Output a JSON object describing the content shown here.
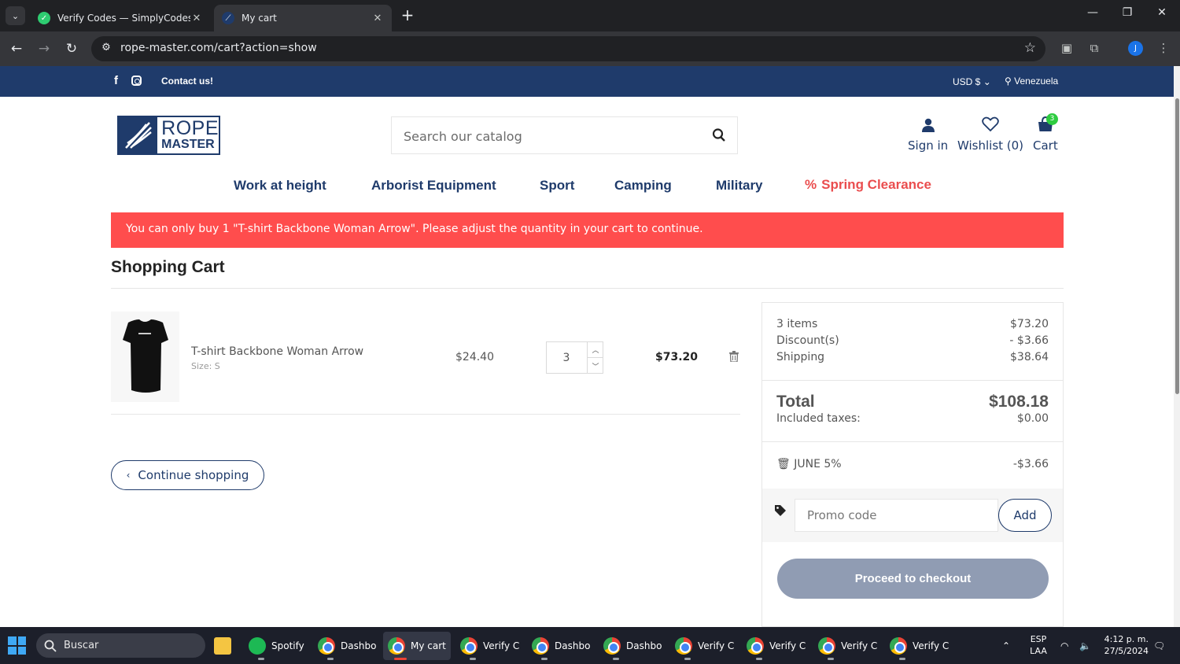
{
  "browser": {
    "tabs": [
      {
        "title": "Verify Codes — SimplyCodes",
        "active": false
      },
      {
        "title": "My cart",
        "active": true
      }
    ],
    "url": "rope-master.com/cart?action=show",
    "profile_initial": "J"
  },
  "topbar": {
    "contact": "Contact us!",
    "currency": "USD $",
    "country": "Venezuela"
  },
  "logo": {
    "line1": "ROPE",
    "line2": "MASTER"
  },
  "search": {
    "placeholder": "Search our catalog"
  },
  "header_links": {
    "sign_in": "Sign in",
    "wishlist": "Wishlist (0)",
    "cart": "Cart",
    "cart_count": "3"
  },
  "menu": [
    "Work at height",
    "Arborist Equipment",
    "Sport",
    "Camping",
    "Military",
    "Spring Clearance"
  ],
  "alert": "You can only buy 1 \"T-shirt Backbone Woman Arrow\". Please adjust the quantity in your cart to continue.",
  "cart": {
    "title": "Shopping Cart",
    "item": {
      "name": "T-shirt Backbone Woman Arrow",
      "size": "Size: S",
      "unit_price": "$24.40",
      "quantity": "3",
      "total": "$73.20"
    },
    "continue_label": "Continue shopping"
  },
  "summary": {
    "items_label": "3 items",
    "items_value": "$73.20",
    "discount_label": "Discount(s)",
    "discount_value": "- $3.66",
    "shipping_label": "Shipping",
    "shipping_value": "$38.64",
    "total_label": "Total",
    "total_value": "$108.18",
    "taxes_label": "Included taxes:",
    "taxes_value": "$0.00",
    "voucher_name": "JUNE 5%",
    "voucher_value": "-$3.66",
    "promo_placeholder": "Promo code",
    "promo_add": "Add",
    "checkout_label": "Proceed to checkout"
  },
  "taskbar": {
    "search_label": "Buscar",
    "items": [
      {
        "label": "Spotify",
        "color": "#1db954"
      },
      {
        "label": "Dashbo",
        "color": "chrome"
      },
      {
        "label": "My cart",
        "color": "chrome"
      },
      {
        "label": "Verify C",
        "color": "chrome"
      },
      {
        "label": "Dashbo",
        "color": "chrome"
      },
      {
        "label": "Dashbo",
        "color": "chrome"
      },
      {
        "label": "Verify C",
        "color": "chrome"
      },
      {
        "label": "Verify C",
        "color": "chrome"
      },
      {
        "label": "Verify C",
        "color": "chrome"
      },
      {
        "label": "Verify C",
        "color": "chrome"
      }
    ],
    "lang_top": "ESP",
    "lang_bottom": "LAA",
    "time": "4:12 p. m.",
    "date": "27/5/2024"
  },
  "colors": {
    "brand_navy": "#1f3b6b",
    "alert_red": "#ff4d4d",
    "clearance_red": "#ea4d4e",
    "checkout_disabled": "#909cb3",
    "cart_badge": "#2ecc40"
  }
}
